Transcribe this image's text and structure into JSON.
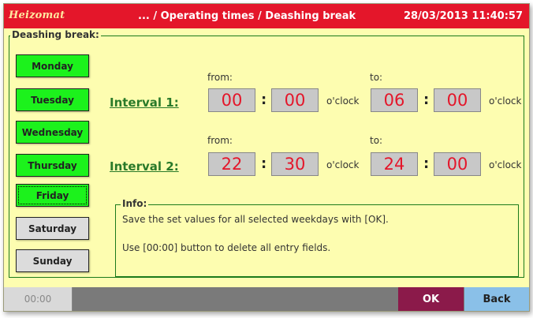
{
  "header": {
    "logo": "Heizomat",
    "breadcrumb": "... / Operating times / Deashing break",
    "datetime": "28/03/2013 11:40:57",
    "background_color": "#e4162a"
  },
  "section": {
    "legend": "Deashing break:"
  },
  "days": [
    {
      "label": "Monday",
      "selected": true
    },
    {
      "label": "Tuesday",
      "selected": true
    },
    {
      "label": "Wednesday",
      "selected": true
    },
    {
      "label": "Thursday",
      "selected": true
    },
    {
      "label": "Friday",
      "selected": true,
      "focused": true
    },
    {
      "label": "Saturday",
      "selected": false
    },
    {
      "label": "Sunday",
      "selected": false
    }
  ],
  "labels": {
    "from": "from:",
    "to": "to:",
    "oclock": "o'clock",
    "colon": ":"
  },
  "intervals": [
    {
      "label": "Interval 1:",
      "from_h": "00",
      "from_m": "00",
      "to_h": "06",
      "to_m": "00"
    },
    {
      "label": "Interval 2:",
      "from_h": "22",
      "from_m": "30",
      "to_h": "24",
      "to_m": "00"
    }
  ],
  "info": {
    "legend": "Info:",
    "line1": "Save the set values for all selected weekdays with [OK].",
    "line2": "Use [00:00] button to delete all entry fields."
  },
  "footer": {
    "time_button": "00:00",
    "ok_label": "OK",
    "back_label": "Back"
  },
  "colors": {
    "selected_day": "#1cf21c",
    "unselected_day": "#dcdcdc",
    "panel": "#fdfdb0",
    "value_text": "#e4162a",
    "ok_button": "#8b1a4a",
    "back_button": "#8ac0e8"
  }
}
